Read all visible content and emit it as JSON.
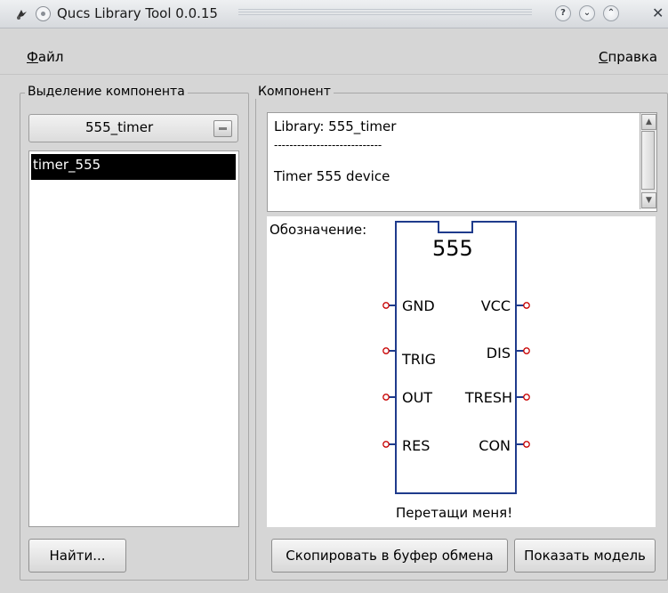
{
  "window": {
    "title": "Qucs Library Tool 0.0.15",
    "buttons": [
      "?",
      "⌄",
      "⌃",
      "✕"
    ]
  },
  "menu": {
    "file_prefix": "Ф",
    "file_rest": "айл",
    "help_prefix": "С",
    "help_rest": "правка"
  },
  "left_group": {
    "title": "Выделение компонента",
    "library_select": "555_timer",
    "components": [
      "timer_555"
    ],
    "selected_component": "timer_555",
    "find_button": "Найти..."
  },
  "right_group": {
    "title": "Компонент",
    "description_lines": [
      "Library: 555_timer",
      "----------------------------",
      "Timer 555 device"
    ],
    "designation_label": "Обозначение:",
    "symbol": {
      "name": "555",
      "left_pins": [
        "GND",
        "TRIG",
        "OUT",
        "RES"
      ],
      "right_pins": [
        "VCC",
        "DIS",
        "TRESH",
        "CON"
      ]
    },
    "drag_hint": "Перетащи меня!",
    "copy_button": "Скопировать в буфер обмена",
    "model_button": "Показать модель"
  },
  "colors": {
    "symbol_stroke": "#1f3b8c",
    "pin_marker": "#c80000",
    "selection": "#000000"
  }
}
